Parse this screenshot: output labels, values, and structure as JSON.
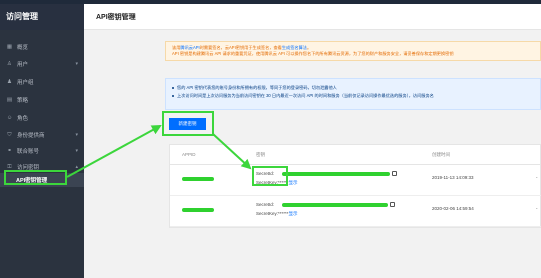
{
  "sidebar": {
    "title": "访问管理",
    "items": [
      {
        "label": "概览",
        "icon": "grid-icon",
        "arrow": ""
      },
      {
        "label": "用户",
        "icon": "user-icon",
        "arrow": "▾"
      },
      {
        "label": "用户组",
        "icon": "user-group-icon",
        "arrow": ""
      },
      {
        "label": "策略",
        "icon": "policy-icon",
        "arrow": ""
      },
      {
        "label": "角色",
        "icon": "role-icon",
        "arrow": ""
      },
      {
        "label": "身份提供商",
        "icon": "identity-provider-icon",
        "arrow": "▾"
      },
      {
        "label": "联合账号",
        "icon": "federated-account-icon",
        "arrow": "▾"
      },
      {
        "label": "访问密钥",
        "icon": "key-icon",
        "arrow": "▴"
      }
    ],
    "active_item": "API密钥管理"
  },
  "header": {
    "title": "API密钥管理"
  },
  "warning": {
    "line1_prefix": "该用",
    "line1_link1": "腾讯云API",
    "line1_mid": "时需要签名，云API密钥用于生成签名，查看",
    "line1_link2": "生成签名算法",
    "line1_suffix": "。",
    "line2": "API 密钥是构建腾讯云 API 请求的重要凭证，使用腾讯云 API 可以操作您名下的所有腾讯云资源，为了您的财产和服务安全，请妥善保存和定期更换密钥"
  },
  "info": {
    "line1": "您的 API 密钥代表您的账号身份和所拥有的权限，等同于您的登录密码，切勿泄露他人",
    "line2": "上次访问时间是上次访问服务为当前访问密钥在 30 日内最近一次访问 API 的时间和服务（当前仅记录访问操作最优选的服务），访问服务名"
  },
  "new_key_button": "新建密钥",
  "table": {
    "headers": [
      "APPID",
      "密钥",
      "创建时间"
    ],
    "rows": [
      {
        "secret_id_label": "SecretId:",
        "secret_key_label": "SecretKey:",
        "secret_key_mask": "******",
        "show_label": "显示",
        "created": "2019-11-13 14:09:33",
        "action": "-"
      },
      {
        "secret_id_label": "SecretId:",
        "secret_key_label": "SecretKey:",
        "secret_key_mask": "******",
        "show_label": "显示",
        "created": "2020-02-06 14:59:54",
        "action": "-"
      }
    ]
  },
  "colors": {
    "accent": "#006eff",
    "annotation_green": "#3cd63c",
    "sidebar_bg": "#2b333f"
  }
}
